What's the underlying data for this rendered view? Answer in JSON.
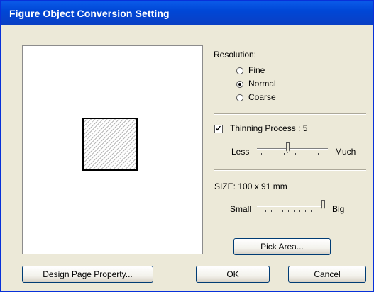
{
  "window": {
    "title": "Figure Object Conversion Setting"
  },
  "resolution": {
    "label": "Resolution:",
    "options": [
      {
        "label": "Fine",
        "selected": false
      },
      {
        "label": "Normal",
        "selected": true
      },
      {
        "label": "Coarse",
        "selected": false
      }
    ]
  },
  "thinning": {
    "label": "Thinning Process : 5",
    "checked": true,
    "value": 5,
    "min_label": "Less",
    "max_label": "Much"
  },
  "size": {
    "label": "SIZE:  100 x  91 mm",
    "min_label": "Small",
    "max_label": "Big",
    "level": 1.0
  },
  "buttons": {
    "pick_area": "Pick Area...",
    "design_page_property": "Design Page Property...",
    "ok": "OK",
    "cancel": "Cancel"
  }
}
